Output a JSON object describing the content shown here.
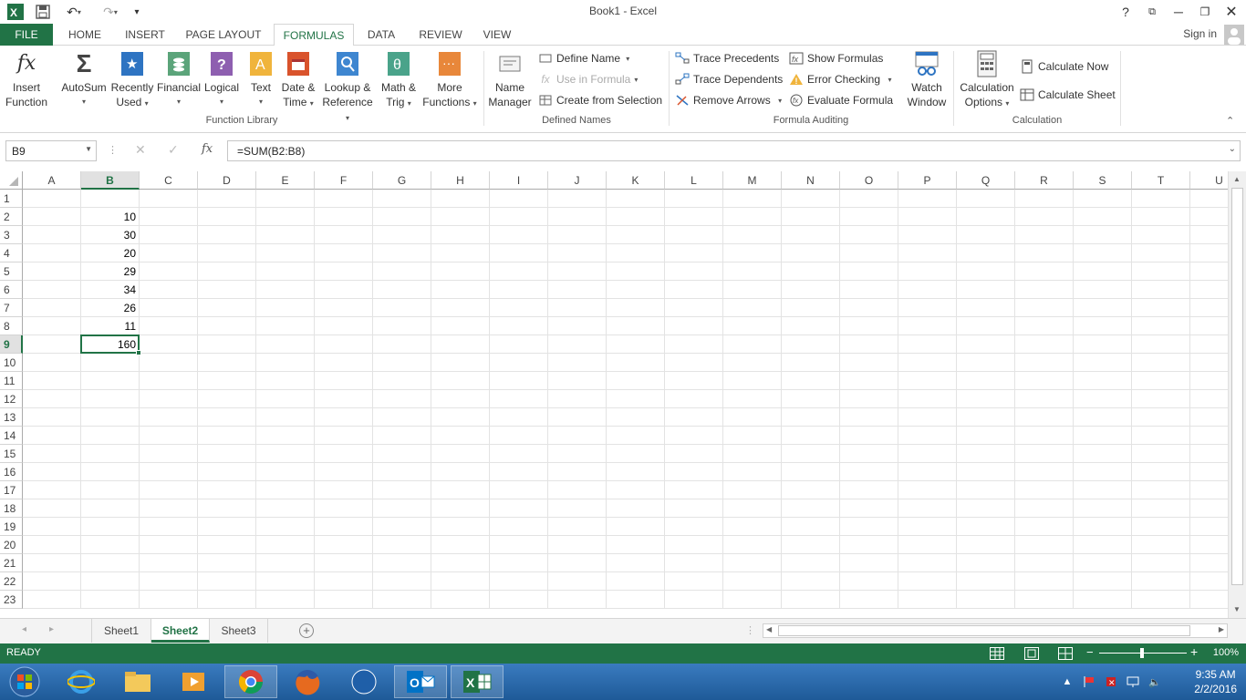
{
  "window": {
    "title": "Book1 - Excel"
  },
  "tabs": {
    "file": "FILE",
    "home": "HOME",
    "insert": "INSERT",
    "page_layout": "PAGE LAYOUT",
    "formulas": "FORMULAS",
    "data": "DATA",
    "review": "REVIEW",
    "view": "VIEW"
  },
  "account": {
    "sign_in": "Sign in"
  },
  "ribbon": {
    "insert_function": [
      "Insert",
      "Function"
    ],
    "autosum": "AutoSum",
    "recently_used": [
      "Recently",
      "Used"
    ],
    "financial": "Financial",
    "logical": "Logical",
    "text": "Text",
    "date_time": [
      "Date &",
      "Time"
    ],
    "lookup_reference": [
      "Lookup &",
      "Reference"
    ],
    "math_trig": [
      "Math &",
      "Trig"
    ],
    "more_functions": [
      "More",
      "Functions"
    ],
    "function_library_label": "Function Library",
    "name_manager": [
      "Name",
      "Manager"
    ],
    "define_name": "Define Name",
    "use_in_formula": "Use in Formula",
    "create_from_selection": "Create from Selection",
    "defined_names_label": "Defined Names",
    "trace_precedents": "Trace Precedents",
    "trace_dependents": "Trace Dependents",
    "remove_arrows": "Remove Arrows",
    "show_formulas": "Show Formulas",
    "error_checking": "Error Checking",
    "evaluate_formula": "Evaluate Formula",
    "watch_window": [
      "Watch",
      "Window"
    ],
    "formula_auditing_label": "Formula Auditing",
    "calculation_options": [
      "Calculation",
      "Options"
    ],
    "calculate_now": "Calculate Now",
    "calculate_sheet": "Calculate Sheet",
    "calculation_label": "Calculation"
  },
  "formula_bar": {
    "name_box": "B9",
    "formula": "=SUM(B2:B8)",
    "fx": "fx"
  },
  "grid": {
    "columns": [
      "A",
      "B",
      "C",
      "D",
      "E",
      "F",
      "G",
      "H",
      "I",
      "J",
      "K",
      "L",
      "M",
      "N",
      "O",
      "P",
      "Q",
      "R",
      "S",
      "T",
      "U"
    ],
    "rows": [
      "1",
      "2",
      "3",
      "4",
      "5",
      "6",
      "7",
      "8",
      "9",
      "10",
      "11",
      "12",
      "13",
      "14",
      "15",
      "16",
      "17",
      "18",
      "19",
      "20",
      "21",
      "22",
      "23"
    ],
    "selected_column": "B",
    "selected_row": "9",
    "values_col_b": [
      "",
      "10",
      "30",
      "20",
      "29",
      "34",
      "26",
      "11",
      "160"
    ]
  },
  "sheets": [
    "Sheet1",
    "Sheet2",
    "Sheet3"
  ],
  "active_sheet": "Sheet2",
  "status": {
    "mode": "READY",
    "zoom": "100%"
  },
  "clock": {
    "time": "9:35 AM",
    "date": "2/2/2016"
  },
  "colors": {
    "accent": "#217346",
    "taskbar": "#2b6cb0"
  }
}
